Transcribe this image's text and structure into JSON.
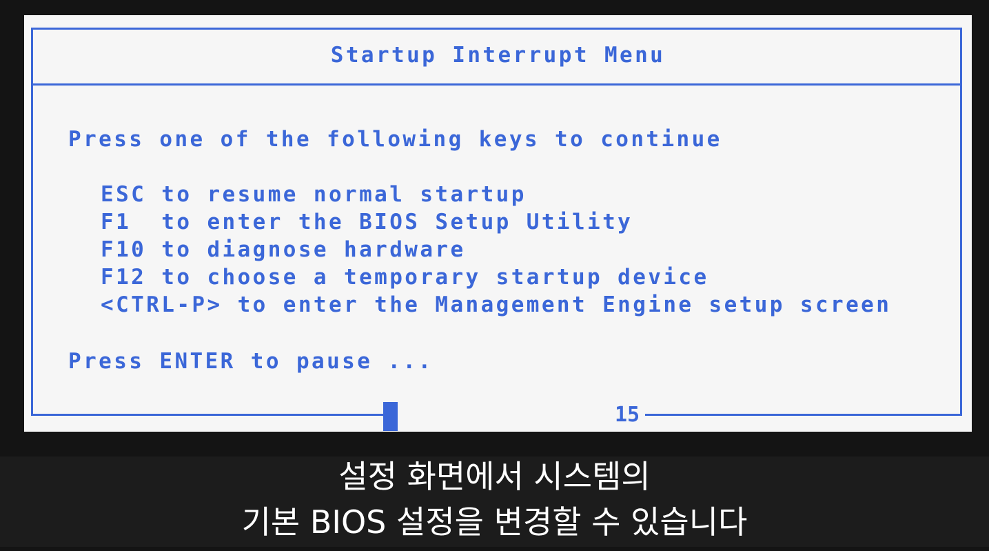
{
  "bios": {
    "title": "Startup Interrupt Menu",
    "prompt": "Press one of the following keys to continue",
    "options": [
      "ESC to resume normal startup",
      "F1  to enter the BIOS Setup Utility",
      "F10 to diagnose hardware",
      "F12 to choose a temporary startup device",
      "<CTRL-P> to enter the Management Engine setup screen"
    ],
    "pause_prompt": "Press ENTER to pause ...",
    "countdown": "15",
    "accent_color": "#3b67d8",
    "background_color": "#f6f6f6"
  },
  "subtitles": {
    "line1": "설정 화면에서 시스템의",
    "line2": "기본 BIOS 설정을 변경할 수 있습니다"
  }
}
